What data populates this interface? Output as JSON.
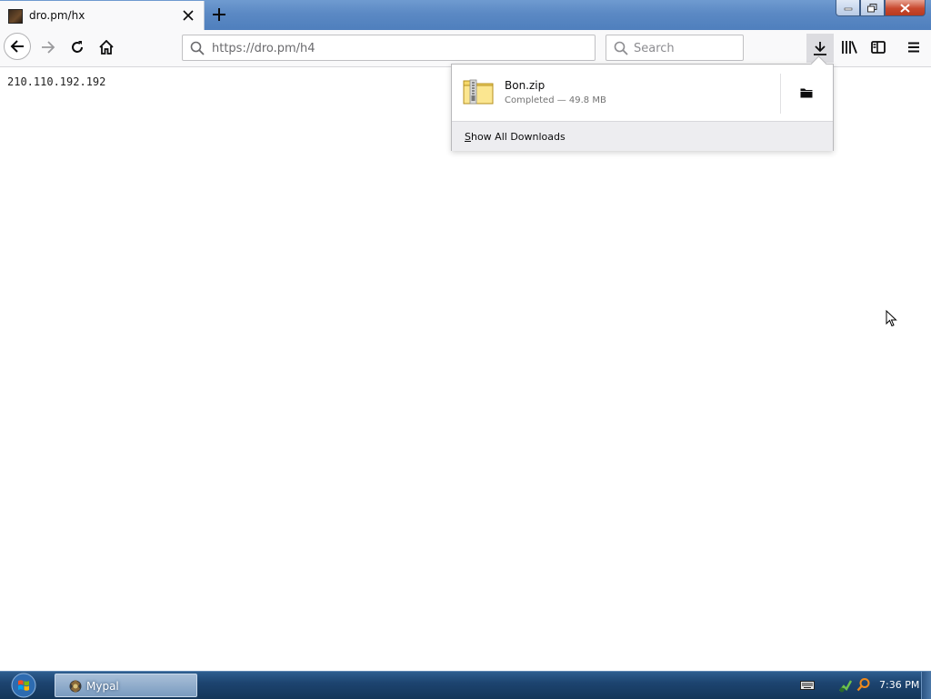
{
  "window": {
    "controls": [
      "minimize-icon",
      "restore-icon",
      "close-icon"
    ]
  },
  "tab": {
    "title": "dro.pm/hx",
    "favicon": "site-favicon"
  },
  "toolbar": {
    "url": "https://dro.pm/h4",
    "search_placeholder": "Search",
    "icons": [
      "back-icon",
      "forward-icon",
      "reload-icon",
      "home-icon",
      "download-icon",
      "library-icon",
      "sidebar-icon",
      "menu-icon"
    ]
  },
  "page": {
    "ip": "210.110.192.192"
  },
  "downloads_panel": {
    "items": [
      {
        "name": "Bon.zip",
        "status": "Completed — 49.8 MB",
        "icon": "zip-file-icon"
      }
    ],
    "show_all_accel": "S",
    "show_all_rest": "how All Downloads"
  },
  "taskbar": {
    "app_label": "Mypal",
    "clock": "7:36 PM"
  },
  "colors": {
    "accent": "#4f7fbd",
    "taskbar": "#1d4470",
    "tab_bg": "#f9f9fa"
  }
}
